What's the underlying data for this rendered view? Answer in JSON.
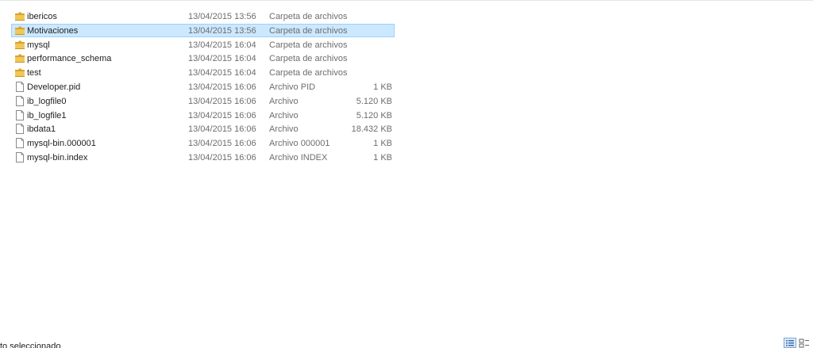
{
  "files": [
    {
      "name": "ibericos",
      "date": "13/04/2015 13:56",
      "type": "Carpeta de archivos",
      "size": "",
      "icon": "folder-icon",
      "selected": false
    },
    {
      "name": "Motivaciones",
      "date": "13/04/2015 13:56",
      "type": "Carpeta de archivos",
      "size": "",
      "icon": "folder-icon",
      "selected": true
    },
    {
      "name": "mysql",
      "date": "13/04/2015 16:04",
      "type": "Carpeta de archivos",
      "size": "",
      "icon": "folder-icon",
      "selected": false
    },
    {
      "name": "performance_schema",
      "date": "13/04/2015 16:04",
      "type": "Carpeta de archivos",
      "size": "",
      "icon": "folder-icon",
      "selected": false
    },
    {
      "name": "test",
      "date": "13/04/2015 16:04",
      "type": "Carpeta de archivos",
      "size": "",
      "icon": "folder-icon",
      "selected": false
    },
    {
      "name": "Developer.pid",
      "date": "13/04/2015 16:06",
      "type": "Archivo PID",
      "size": "1 KB",
      "icon": "file-icon",
      "selected": false
    },
    {
      "name": "ib_logfile0",
      "date": "13/04/2015 16:06",
      "type": "Archivo",
      "size": "5.120 KB",
      "icon": "file-icon",
      "selected": false
    },
    {
      "name": "ib_logfile1",
      "date": "13/04/2015 16:06",
      "type": "Archivo",
      "size": "5.120 KB",
      "icon": "file-icon",
      "selected": false
    },
    {
      "name": "ibdata1",
      "date": "13/04/2015 16:06",
      "type": "Archivo",
      "size": "18.432 KB",
      "icon": "file-icon",
      "selected": false
    },
    {
      "name": "mysql-bin.000001",
      "date": "13/04/2015 16:06",
      "type": "Archivo 000001",
      "size": "1 KB",
      "icon": "file-icon",
      "selected": false
    },
    {
      "name": "mysql-bin.index",
      "date": "13/04/2015 16:06",
      "type": "Archivo INDEX",
      "size": "1 KB",
      "icon": "file-icon",
      "selected": false
    }
  ],
  "status_bar": {
    "text": "to seleccionado"
  },
  "colors": {
    "selection_bg": "#cce8ff",
    "selection_border": "#99d1ff",
    "folder": "#e8b83c",
    "secondary_text": "#6d6d6d"
  }
}
